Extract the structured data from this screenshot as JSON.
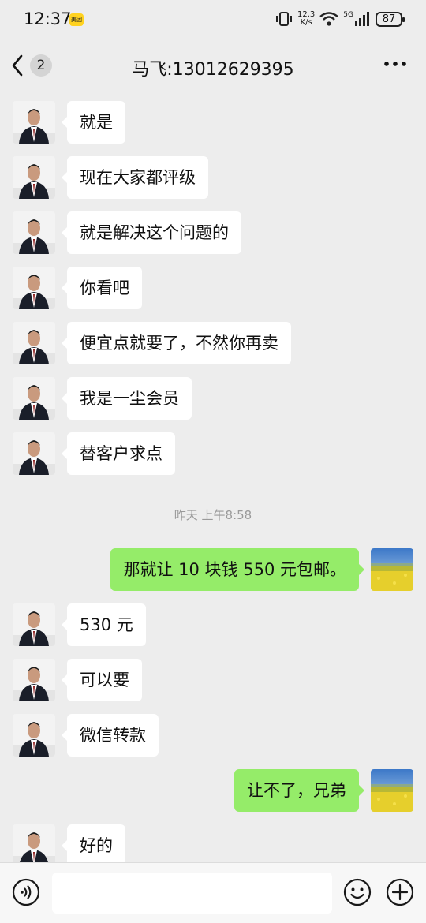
{
  "status_bar": {
    "time": "12:37",
    "app_badge": "美团",
    "net_speed_value": "12.3",
    "net_speed_unit": "K/s",
    "network_type": "5G",
    "battery": "87"
  },
  "header": {
    "back_count": "2",
    "title": "马飞:13012629395",
    "more_icon": "more-dots-icon"
  },
  "messages": [
    {
      "side": "left",
      "text": "就是"
    },
    {
      "side": "left",
      "text": "现在大家都评级"
    },
    {
      "side": "left",
      "text": "就是解决这个问题的"
    },
    {
      "side": "left",
      "text": "你看吧"
    },
    {
      "side": "left",
      "text": "便宜点就要了，不然你再卖"
    },
    {
      "side": "left",
      "text": "我是一尘会员"
    },
    {
      "side": "left",
      "text": "替客户求点"
    },
    {
      "type": "time",
      "text": "昨天 上午8:58"
    },
    {
      "side": "right",
      "text": "那就让 10 块钱 550 元包邮。"
    },
    {
      "side": "left",
      "text": "530 元"
    },
    {
      "side": "left",
      "text": "可以要"
    },
    {
      "side": "left",
      "text": "微信转款"
    },
    {
      "side": "right",
      "text": "让不了，兄弟"
    },
    {
      "side": "left",
      "text": "好的"
    }
  ],
  "input_bar": {
    "input_value": "",
    "icons": [
      "voice-icon",
      "emoji-icon",
      "plus-icon"
    ]
  },
  "colors": {
    "background": "#ededed",
    "bubble_self": "#95ec69",
    "bubble_other": "#ffffff"
  }
}
